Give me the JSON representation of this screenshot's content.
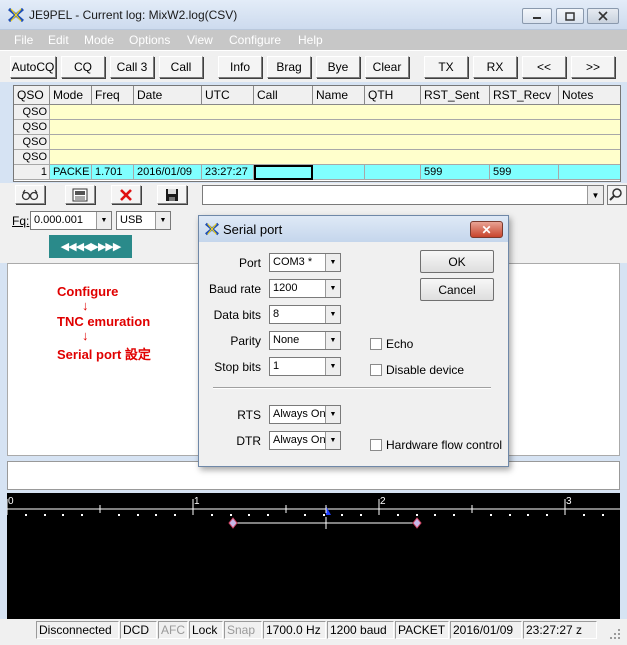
{
  "window": {
    "title": "JE9PEL - Current log: MixW2.log(CSV)",
    "menu": [
      "File",
      "Edit",
      "Mode",
      "Options",
      "View",
      "Configure",
      "Help"
    ]
  },
  "toolbar": {
    "buttons": [
      "AutoCQ",
      "CQ",
      "Call 3",
      "Call",
      "Info",
      "Brag",
      "Bye",
      "Clear",
      "TX",
      "RX",
      "<<",
      ">>"
    ]
  },
  "log_grid": {
    "columns": [
      "QSO",
      "Mode",
      "Freq",
      "Date",
      "UTC",
      "Call",
      "Name",
      "QTH",
      "RST_Sent",
      "RST_Recv",
      "Notes"
    ],
    "empty_row_label": "QSO",
    "current_row": {
      "index": "1",
      "mode": "PACKE",
      "freq": "1.701",
      "date": "2016/01/09",
      "utc": "23:27:27",
      "call": "",
      "name": "",
      "qth": "",
      "rst_sent": "599",
      "rst_recv": "599",
      "notes": ""
    }
  },
  "freq": {
    "label": "Fq:",
    "value": "0.000.001",
    "mode": "USB",
    "arrows": "◀◀◀◀▶▶▶▶"
  },
  "annotation": {
    "line1": "Configure",
    "arrow1": "↓",
    "line2": "TNC emuration",
    "arrow2": "↓",
    "line3": "Serial port 設定"
  },
  "waterfall": {
    "scale_labels": [
      "0",
      "1",
      "2",
      "3"
    ]
  },
  "status": {
    "connection": "Disconnected",
    "dcd": "DCD",
    "afc": "AFC",
    "lock": "Lock",
    "snap": "Snap",
    "freq": "1700.0 Hz",
    "baud": "1200 baud",
    "mode": "PACKET",
    "date": "2016/01/09",
    "time": "23:27:27 z"
  },
  "dialog": {
    "title": "Serial port",
    "port_label": "Port",
    "port_value": "COM3 *",
    "baud_label": "Baud rate",
    "baud_value": "1200",
    "databits_label": "Data bits",
    "databits_value": "8",
    "parity_label": "Parity",
    "parity_value": "None",
    "stopbits_label": "Stop bits",
    "stopbits_value": "1",
    "rts_label": "RTS",
    "rts_value": "Always On",
    "dtr_label": "DTR",
    "dtr_value": "Always On",
    "ok_label": "OK",
    "cancel_label": "Cancel",
    "echo_label": "Echo",
    "disable_label": "Disable device",
    "hwflow_label": "Hardware flow control",
    "close_glyph": "✕"
  }
}
